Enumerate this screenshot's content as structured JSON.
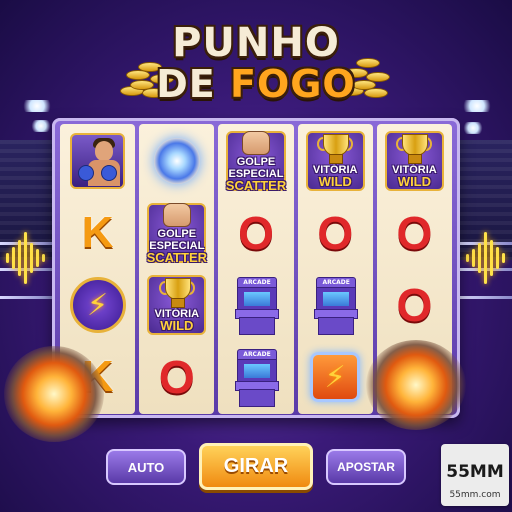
{
  "title": {
    "line1": "PUNHO",
    "line2_a": "DE",
    "line2_b": "FOGO"
  },
  "reels": [
    [
      {
        "symbol": "boxer"
      },
      {
        "symbol": "K",
        "text": "K"
      },
      {
        "symbol": "bolt-badge"
      },
      {
        "symbol": "K",
        "text": "K"
      }
    ],
    [
      {
        "symbol": "orb"
      },
      {
        "symbol": "scatter",
        "line1": "GOLPE",
        "line2": "ESPECIAL",
        "line3": "SCATTER"
      },
      {
        "symbol": "wild",
        "line1": "VITÓRIA",
        "line2": "WILD"
      },
      {
        "symbol": "O",
        "text": "O"
      }
    ],
    [
      {
        "symbol": "scatter",
        "line1": "GOLPE",
        "line2": "ESPECIAL",
        "line3": "SCATTER"
      },
      {
        "symbol": "O",
        "text": "O"
      },
      {
        "symbol": "arcade",
        "label": "ARCADE"
      },
      {
        "symbol": "arcade",
        "label": "ARCADE"
      }
    ],
    [
      {
        "symbol": "wild",
        "line1": "VITÓRIA",
        "line2": "WILD"
      },
      {
        "symbol": "O",
        "text": "O"
      },
      {
        "symbol": "arcade",
        "label": "ARCADE"
      },
      {
        "symbol": "bolt-tile"
      }
    ],
    [
      {
        "symbol": "wild",
        "line1": "VITÓRIA",
        "line2": "WILD"
      },
      {
        "symbol": "O",
        "text": "O"
      },
      {
        "symbol": "O",
        "text": "O"
      },
      {
        "symbol": "explosion"
      }
    ]
  ],
  "buttons": {
    "auto": "AUTO",
    "spin": "GIRAR",
    "bet": "APOSTAR"
  },
  "watermark": {
    "logo": "55MM",
    "url": "55mm.com"
  },
  "colors": {
    "accent": "#ffa51e",
    "k_symbol": "#f59a12",
    "o_symbol": "#e0282a",
    "button_primary": "#f08a10",
    "button_secondary": "#5a3aa8"
  }
}
